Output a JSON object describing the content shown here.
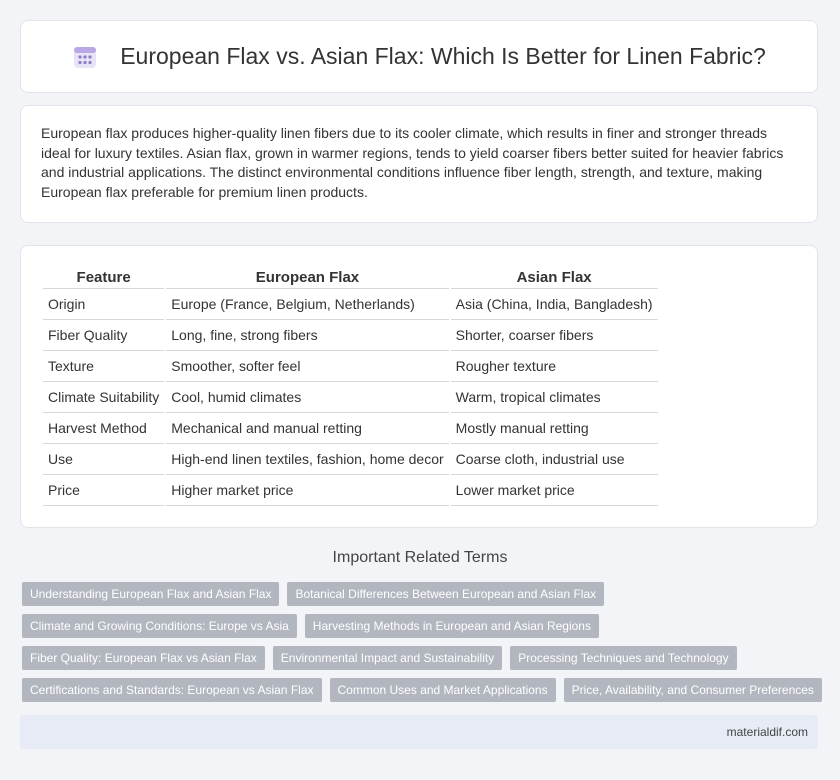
{
  "header": {
    "title": "European Flax vs. Asian Flax: Which Is Better for Linen Fabric?"
  },
  "intro": {
    "text": "European flax produces higher-quality linen fibers due to its cooler climate, which results in finer and stronger threads ideal for luxury textiles. Asian flax, grown in warmer regions, tends to yield coarser fibers better suited for heavier fabrics and industrial applications. The distinct environmental conditions influence fiber length, strength, and texture, making European flax preferable for premium linen products."
  },
  "table": {
    "headers": [
      "Feature",
      "European Flax",
      "Asian Flax"
    ],
    "rows": [
      [
        "Origin",
        "Europe (France, Belgium, Netherlands)",
        "Asia (China, India, Bangladesh)"
      ],
      [
        "Fiber Quality",
        "Long, fine, strong fibers",
        "Shorter, coarser fibers"
      ],
      [
        "Texture",
        "Smoother, softer feel",
        "Rougher texture"
      ],
      [
        "Climate Suitability",
        "Cool, humid climates",
        "Warm, tropical climates"
      ],
      [
        "Harvest Method",
        "Mechanical and manual retting",
        "Mostly manual retting"
      ],
      [
        "Use",
        "High-end linen textiles, fashion, home decor",
        "Coarse cloth, industrial use"
      ],
      [
        "Price",
        "Higher market price",
        "Lower market price"
      ]
    ]
  },
  "related": {
    "title": "Important Related Terms",
    "rows": [
      [
        "Understanding European Flax and Asian Flax",
        "Botanical Differences Between European and Asian Flax"
      ],
      [
        "Climate and Growing Conditions: Europe vs Asia",
        "Harvesting Methods in European and Asian Regions"
      ],
      [
        "Fiber Quality: European Flax vs Asian Flax",
        "Environmental Impact and Sustainability",
        "Processing Techniques and Technology"
      ],
      [
        "Certifications and Standards: European vs Asian Flax",
        "Common Uses and Market Applications",
        "Price, Availability, and Consumer Preferences"
      ]
    ]
  },
  "footer": {
    "site": "materialdif.com"
  },
  "colors": {
    "tag_bg": "#b2b6bf",
    "footer_bg": "#e6ebf5",
    "page_bg": "#f3f4f8"
  },
  "icons": {
    "header_logo": "calendar-grid-icon"
  }
}
